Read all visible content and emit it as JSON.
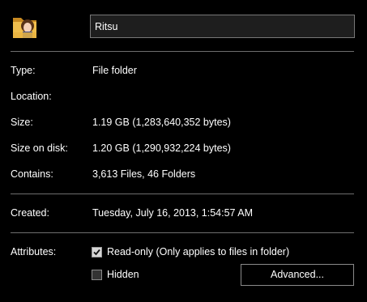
{
  "name": {
    "value": "Ritsu"
  },
  "icon": "folder-with-avatar-icon",
  "general": {
    "type_label": "Type:",
    "type_value": "File folder",
    "location_label": "Location:",
    "location_value": "",
    "size_label": "Size:",
    "size_value": "1.19 GB (1,283,640,352 bytes)",
    "size_on_disk_label": "Size on disk:",
    "size_on_disk_value": "1.20 GB (1,290,932,224 bytes)",
    "contains_label": "Contains:",
    "contains_value": "3,613 Files, 46 Folders"
  },
  "dates": {
    "created_label": "Created:",
    "created_value": "Tuesday, July 16, 2013, 1:54:57 AM"
  },
  "attributes": {
    "label": "Attributes:",
    "read_only": {
      "label": "Read-only (Only applies to files in folder)",
      "checked": true
    },
    "hidden": {
      "label": "Hidden",
      "checked": false
    },
    "advanced_button": "Advanced..."
  },
  "colors": {
    "background": "#000000",
    "text": "#ffffff",
    "separator": "#6e6e6e",
    "input_bg": "#1e1e1e"
  }
}
